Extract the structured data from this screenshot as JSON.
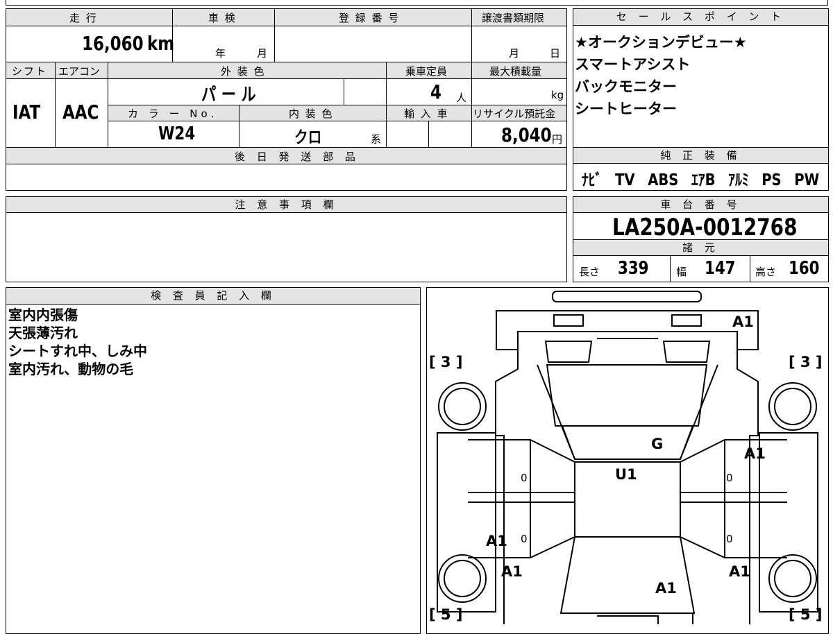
{
  "top": {
    "mileage_label": "走 行",
    "mileage_value": "16,060",
    "mileage_unit": "km",
    "inspection_label": "車 検",
    "inspection_year": "年",
    "inspection_month": "月",
    "registration_label": "登 録 番 号",
    "transfer_label": "譲渡書類期限",
    "transfer_month": "月",
    "transfer_day": "日",
    "shift_label": "シフト",
    "shift_value": "IAT",
    "ac_label": "エアコン",
    "ac_value": "AAC",
    "exterior_label": "外 装 色",
    "exterior_value": "パ ー ル",
    "capacity_label": "乗車定員",
    "capacity_value": "4",
    "capacity_unit": "人",
    "maxload_label": "最大積載量",
    "maxload_unit": "kg",
    "color_no_label": "カ ラ ー No.",
    "color_no_value": "W24",
    "interior_label": "内 装 色",
    "interior_value": "クロ",
    "interior_suffix": "系",
    "import_label": "輸 入 車",
    "recycle_label": "リサイクル預託金",
    "recycle_value": "8,040",
    "recycle_unit": "円",
    "later_parts_label": "後 日 発 送 部 品"
  },
  "sales": {
    "title": "セ ー ル ス ポ イ ン ト",
    "points": [
      "★オークションデビュー★",
      "スマートアシスト",
      "バックモニター",
      "シートヒーター"
    ]
  },
  "equipment": {
    "title": "純 正 装 備",
    "items": [
      "ﾅﾋﾞ",
      "TV",
      "ABS",
      "ｴｱB",
      "ｱﾙﾐ",
      "PS",
      "PW"
    ]
  },
  "notes": {
    "title": "注 意 事 項 欄"
  },
  "chassis": {
    "title": "車 台 番 号",
    "value": "LA250A-0012768",
    "specs_title": "諸 元",
    "length_label": "長さ",
    "length_value": "339",
    "width_label": "幅",
    "width_value": "147",
    "height_label": "高さ",
    "height_value": "160"
  },
  "inspector": {
    "title": "検 査 員 記 入 欄",
    "lines": [
      "室内内張傷",
      "天張薄汚れ",
      "シートすれ中、しみ中",
      "室内汚れ、動物の毛"
    ]
  },
  "diagram": {
    "marks": {
      "rear_top": "A1",
      "left_bracket_top": "[ 3 ]",
      "right_bracket_top": "[ 3 ]",
      "roof": "G",
      "right_door_front": "A1",
      "center": "U1",
      "left_door_rear": "A1",
      "left_rear": "A1",
      "right_rear": "A1",
      "bottom": "A1",
      "left_bracket_bottom": "[ 5 ]",
      "right_bracket_bottom": "[ 5 ]",
      "door_zero": "0"
    }
  }
}
